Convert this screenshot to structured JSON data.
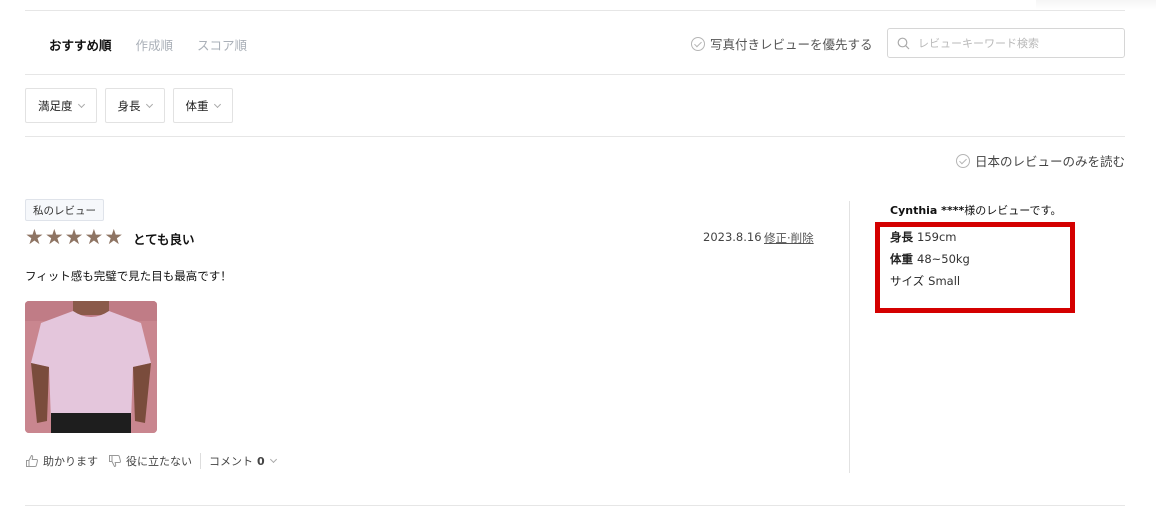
{
  "sort": {
    "tabs": [
      {
        "label": "おすすめ順",
        "active": true
      },
      {
        "label": "作成順",
        "active": false
      },
      {
        "label": "スコア順",
        "active": false
      }
    ]
  },
  "photo_priority_label": "写真付きレビューを優先する",
  "search": {
    "placeholder": "レビューキーワード検索",
    "value": ""
  },
  "filters": [
    {
      "label": "満足度"
    },
    {
      "label": "身長"
    },
    {
      "label": "体重"
    }
  ],
  "japan_only_label": "日本のレビューのみを読む",
  "review": {
    "badge": "私のレビュー",
    "rating": 5,
    "title": "とても良い",
    "date": "2023.8.16",
    "edit_label": "修正·削除",
    "body": "フィット感も完璧で見た目も最高です！",
    "helpful_label": "助かります",
    "not_helpful_label": "役に立たない",
    "comment_label": "コメント",
    "comment_count": "0"
  },
  "reviewer": {
    "name": "Cynthia ****",
    "suffix": "様のレビューです。",
    "height_label": "身長",
    "height_value": "159cm",
    "weight_label": "体重",
    "weight_value": "48~50kg",
    "size_label": "サイズ",
    "size_value": "Small"
  },
  "colors": {
    "star": "#8e7463",
    "highlight_box": "#d40000",
    "photo_bg": "#c9868f",
    "shirt": "#e4c6dc"
  },
  "icons": {
    "rating": "star-icon",
    "search": "search-icon",
    "check": "check-circle-icon",
    "helpful": "thumbs-up-icon",
    "not_helpful": "thumbs-down-icon",
    "dropdown": "chevron-down-icon"
  }
}
